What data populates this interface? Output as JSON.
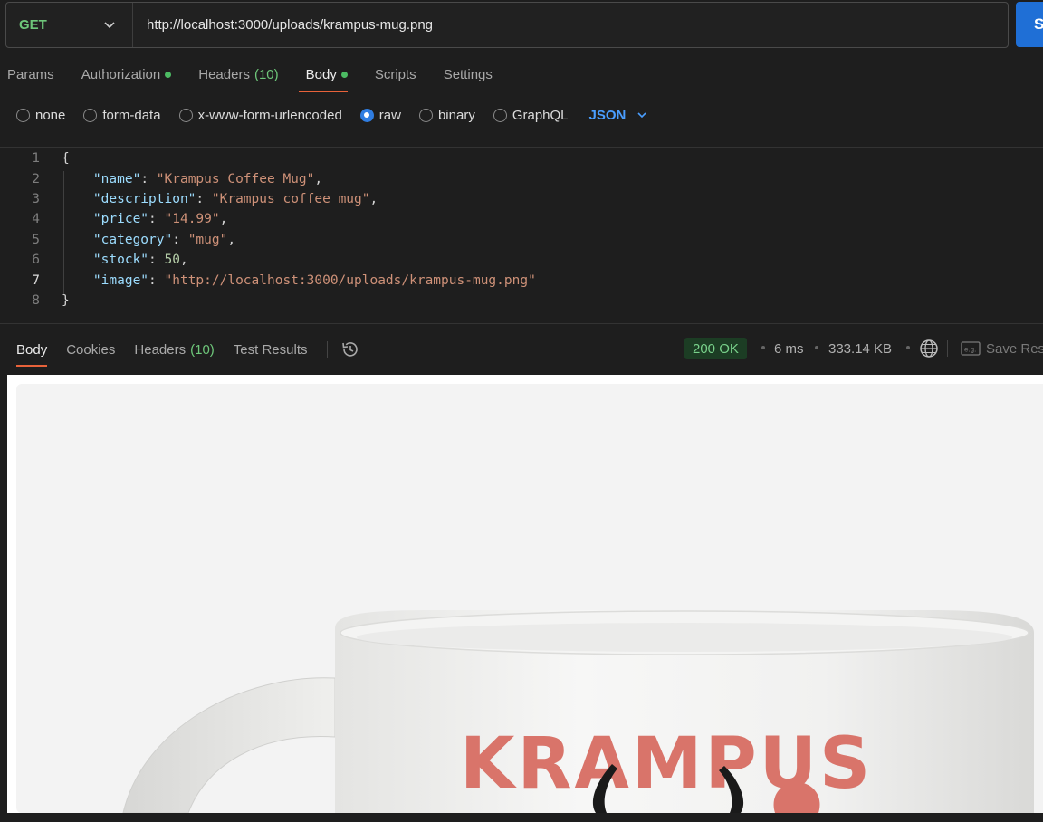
{
  "request": {
    "method": "GET",
    "url": "http://localhost:3000/uploads/krampus-mug.png",
    "send_label": "S"
  },
  "request_tabs": [
    {
      "label": "Params"
    },
    {
      "label": "Authorization",
      "dot": true
    },
    {
      "label": "Headers",
      "count": "(10)"
    },
    {
      "label": "Body",
      "dot": true,
      "active": true
    },
    {
      "label": "Scripts"
    },
    {
      "label": "Settings"
    }
  ],
  "body_types": [
    "none",
    "form-data",
    "x-www-form-urlencoded",
    "raw",
    "binary",
    "GraphQL"
  ],
  "selected_body_type": "raw",
  "language": "JSON",
  "code_lines": [
    {
      "num": "1",
      "text": "{"
    },
    {
      "num": "2",
      "key": "\"name\"",
      "value": "\"Krampus Coffee Mug\"",
      "type": "string",
      "trail": ","
    },
    {
      "num": "3",
      "key": "\"description\"",
      "value": "\"Krampus coffee mug\"",
      "type": "string",
      "trail": ","
    },
    {
      "num": "4",
      "key": "\"price\"",
      "value": "\"14.99\"",
      "type": "string",
      "trail": ","
    },
    {
      "num": "5",
      "key": "\"category\"",
      "value": "\"mug\"",
      "type": "string",
      "trail": ","
    },
    {
      "num": "6",
      "key": "\"stock\"",
      "value": "50",
      "type": "number",
      "trail": ","
    },
    {
      "num": "7",
      "key": "\"image\"",
      "value": "\"http://localhost:3000/uploads/krampus-mug.png\"",
      "type": "string",
      "trail": ""
    },
    {
      "num": "8",
      "text": "}"
    }
  ],
  "response_tabs": [
    {
      "label": "Body",
      "active": true
    },
    {
      "label": "Cookies"
    },
    {
      "label": "Headers",
      "count": "(10)"
    },
    {
      "label": "Test Results"
    }
  ],
  "response": {
    "status": "200 OK",
    "time": "6 ms",
    "size": "333.14 KB",
    "save_label": "Save Res"
  },
  "image": {
    "mug_text": "KRAMPUS"
  },
  "colors": {
    "accent": "#e8623a",
    "method": "#6ec77a",
    "send": "#1f6fd6",
    "mug_text": "#d9746a"
  }
}
